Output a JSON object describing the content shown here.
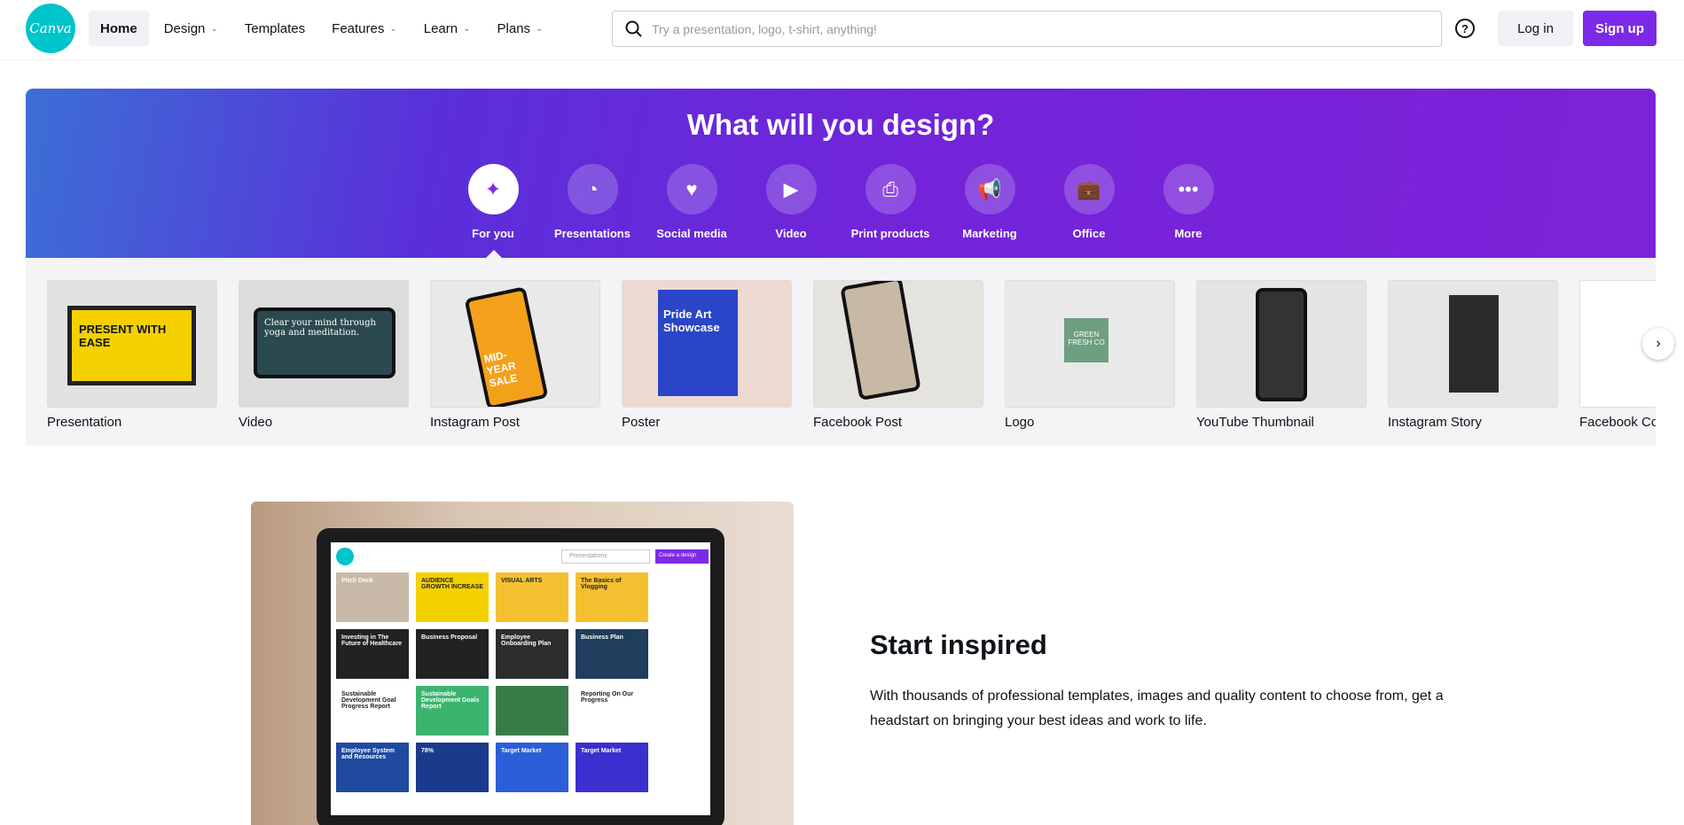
{
  "nav": {
    "logo": "Canva",
    "items": [
      {
        "label": "Home",
        "dropdown": false
      },
      {
        "label": "Design",
        "dropdown": true
      },
      {
        "label": "Templates",
        "dropdown": false
      },
      {
        "label": "Features",
        "dropdown": true
      },
      {
        "label": "Learn",
        "dropdown": true
      },
      {
        "label": "Plans",
        "dropdown": true
      }
    ],
    "search_placeholder": "Try a presentation, logo, t-shirt, anything!",
    "help": "?",
    "login": "Log in",
    "signup": "Sign up",
    "accent": "#7d2ae8"
  },
  "hero": {
    "title": "What will you design?",
    "categories": [
      {
        "label": "For you",
        "icon": "sparkle-icon"
      },
      {
        "label": "Presentations",
        "icon": "presentation-icon"
      },
      {
        "label": "Social media",
        "icon": "heart-icon"
      },
      {
        "label": "Video",
        "icon": "video-icon"
      },
      {
        "label": "Print products",
        "icon": "printer-icon"
      },
      {
        "label": "Marketing",
        "icon": "megaphone-icon"
      },
      {
        "label": "Office",
        "icon": "briefcase-icon"
      },
      {
        "label": "More",
        "icon": "more-icon"
      }
    ],
    "selected": "For you"
  },
  "designs": [
    {
      "label": "Presentation",
      "thumb_text": "PRESENT WITH EASE"
    },
    {
      "label": "Video",
      "thumb_text": "Clear your mind through yoga and meditation."
    },
    {
      "label": "Instagram Post",
      "thumb_text": "MID-YEAR SALE"
    },
    {
      "label": "Poster",
      "thumb_text": "Pride Art Showcase"
    },
    {
      "label": "Facebook Post",
      "thumb_text": ""
    },
    {
      "label": "Logo",
      "thumb_text": "GREEN FRESH CO"
    },
    {
      "label": "YouTube Thumbnail",
      "thumb_text": ""
    },
    {
      "label": "Instagram Story",
      "thumb_text": ""
    },
    {
      "label": "Facebook Cover",
      "thumb_text": ""
    }
  ],
  "promo": {
    "title": "Start inspired",
    "body": "With thousands of professional templates, images and quality content to choose from, get a headstart on bringing your best ideas and work to life.",
    "screen": {
      "search": "Presentations",
      "create": "Create a design",
      "tiles": [
        "Pitch Deck",
        "AUDIENCE GROWTH INCREASE",
        "VISUAL ARTS",
        "The Basics of Vlogging",
        "Investing in The Future of Healthcare",
        "Business Proposal",
        "Employee Onboarding Plan",
        "Business Plan",
        "Sustainable Development Goal Progress Report",
        "Sustainable Development Goals Report",
        "",
        "Reporting On Our Progress",
        "Employee System and Resources",
        "78%",
        "Target Market",
        "Target Market"
      ]
    }
  }
}
